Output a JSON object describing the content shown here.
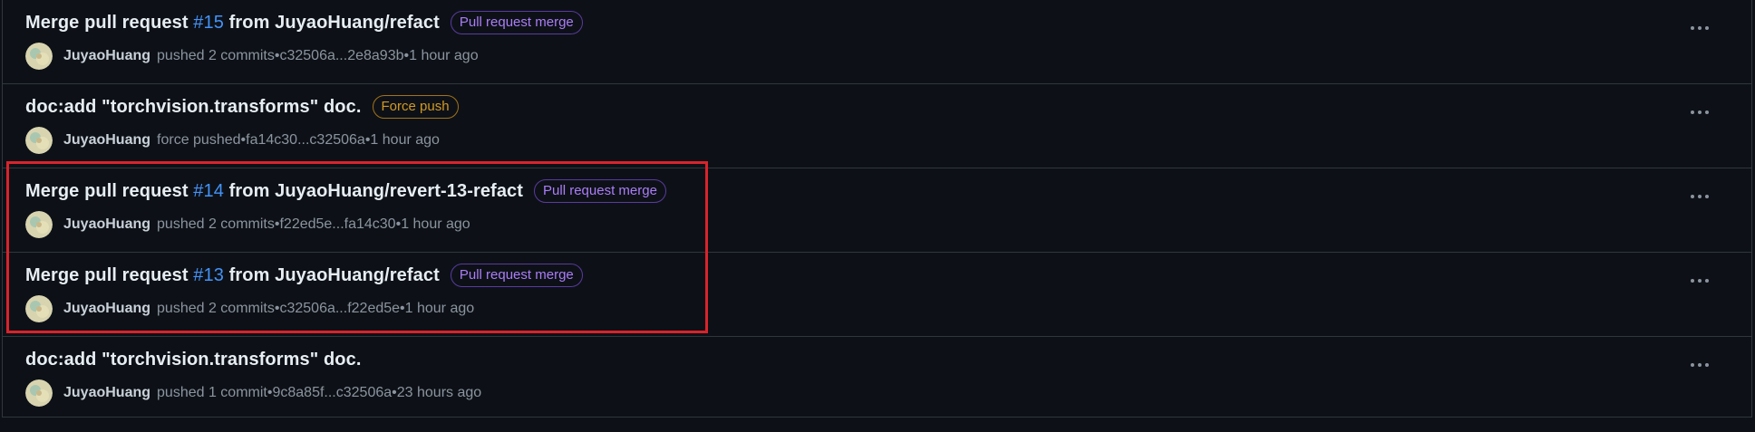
{
  "activity": [
    {
      "title_prefix": "Merge pull request ",
      "pr_number": "#15",
      "title_suffix": " from JuyaoHuang/refact",
      "badge": "Pull request merge",
      "badge_type": "merge",
      "user": "JuyaoHuang",
      "action": "pushed 2 commits",
      "commits": "c32506a...2e8a93b",
      "time": "1 hour ago",
      "more_icon": "kebab-horizontal-icon"
    },
    {
      "title_prefix": "doc:add \"torchvision.transforms\" doc.",
      "pr_number": "",
      "title_suffix": "",
      "badge": "Force push",
      "badge_type": "force",
      "user": "JuyaoHuang",
      "action": "force pushed",
      "commits": "fa14c30...c32506a",
      "time": "1 hour ago",
      "more_icon": "kebab-horizontal-icon"
    },
    {
      "title_prefix": "Merge pull request ",
      "pr_number": "#14",
      "title_suffix": " from JuyaoHuang/revert-13-refact",
      "badge": "Pull request merge",
      "badge_type": "merge",
      "user": "JuyaoHuang",
      "action": "pushed 2 commits",
      "commits": "f22ed5e...fa14c30",
      "time": "1 hour ago",
      "more_icon": "kebab-horizontal-icon"
    },
    {
      "title_prefix": "Merge pull request ",
      "pr_number": "#13",
      "title_suffix": " from JuyaoHuang/refact",
      "badge": "Pull request merge",
      "badge_type": "merge",
      "user": "JuyaoHuang",
      "action": "pushed 2 commits",
      "commits": "c32506a...f22ed5e",
      "time": "1 hour ago",
      "more_icon": "kebab-horizontal-icon"
    },
    {
      "title_prefix": "doc:add \"torchvision.transforms\" doc.",
      "pr_number": "",
      "title_suffix": "",
      "badge": "",
      "badge_type": "",
      "user": "JuyaoHuang",
      "action": "pushed 1 commit",
      "commits": "9c8a85f...c32506a",
      "time": "23 hours ago",
      "more_icon": "kebab-horizontal-icon"
    }
  ],
  "separator": " • ",
  "colors": {
    "background": "#0d1117",
    "border": "#30363d",
    "text": "#e6edf3",
    "muted": "#8b949e",
    "link": "#4493f8",
    "merge_badge": "#ab7df8",
    "force_badge": "#d29922",
    "highlight": "#d9232b"
  }
}
